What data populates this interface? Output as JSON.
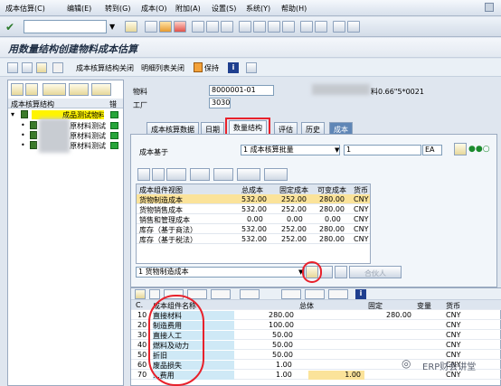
{
  "menu": [
    "成本估算(C)",
    "编辑(E)",
    "转到(G)",
    "成本(O)",
    "附加(A)",
    "设置(S)",
    "系统(Y)",
    "帮助(H)"
  ],
  "title": "用数量结构创建物料成本估算",
  "apptoolbar": {
    "close_structure": "成本核算结构关闭",
    "close_list": "明细列表关闭",
    "save": "保持"
  },
  "left": {
    "col_header": "成本核算结构",
    "col_err": "错",
    "root": "成品测试物料0",
    "children": [
      "原材料测试",
      "原材料测试",
      "原材料测试"
    ]
  },
  "header": {
    "material_label": "物料",
    "material_value": "8000001-01",
    "material_desc": "料0.66\"5*0021",
    "plant_label": "工厂",
    "plant_value": "3030"
  },
  "tabs": [
    "成本核算数据",
    "日期",
    "数量结构",
    "评估",
    "历史",
    "成本"
  ],
  "panel": {
    "basis_label": "成本基于",
    "basis_value": "1 成本核算批量",
    "qty": "1",
    "unit": "EA",
    "grid_headers": [
      "成本组件视图",
      "总成本",
      "固定成本",
      "可变成本",
      "货币"
    ],
    "grid_rows": [
      [
        "货物制造成本",
        "532.00",
        "252.00",
        "280.00",
        "CNY"
      ],
      [
        "货物销售成本",
        "532.00",
        "252.00",
        "280.00",
        "CNY"
      ],
      [
        "销售和管理成本",
        "0.00",
        "0.00",
        "0.00",
        "CNY"
      ],
      [
        "库存（基于商法）",
        "532.00",
        "252.00",
        "280.00",
        "CNY"
      ],
      [
        "库存（基于税法）",
        "532.00",
        "252.00",
        "280.00",
        "CNY"
      ]
    ],
    "view_select": "1 货物制造成本",
    "partner_btn": "合伙人"
  },
  "bottom": {
    "headers": [
      "C.",
      "成本组件名称",
      "总体",
      "固定",
      "变量",
      "货币"
    ],
    "rows": [
      [
        "10",
        "直接材料",
        "280.00",
        "",
        "280.00",
        "CNY"
      ],
      [
        "20",
        "制造费用",
        "100.00",
        "",
        "",
        "CNY"
      ],
      [
        "30",
        "直接人工",
        "50.00",
        "",
        "",
        "CNY"
      ],
      [
        "40",
        "燃料及动力",
        "50.00",
        "",
        "",
        "CNY"
      ],
      [
        "50",
        "折旧",
        "50.00",
        "",
        "",
        "CNY"
      ],
      [
        "60",
        "废品损失",
        "1.00",
        "",
        "",
        "CNY"
      ],
      [
        "70",
        "...费用",
        "1.00",
        "1.00",
        "",
        "CNY"
      ]
    ]
  },
  "watermark": "ERP财会讲堂"
}
